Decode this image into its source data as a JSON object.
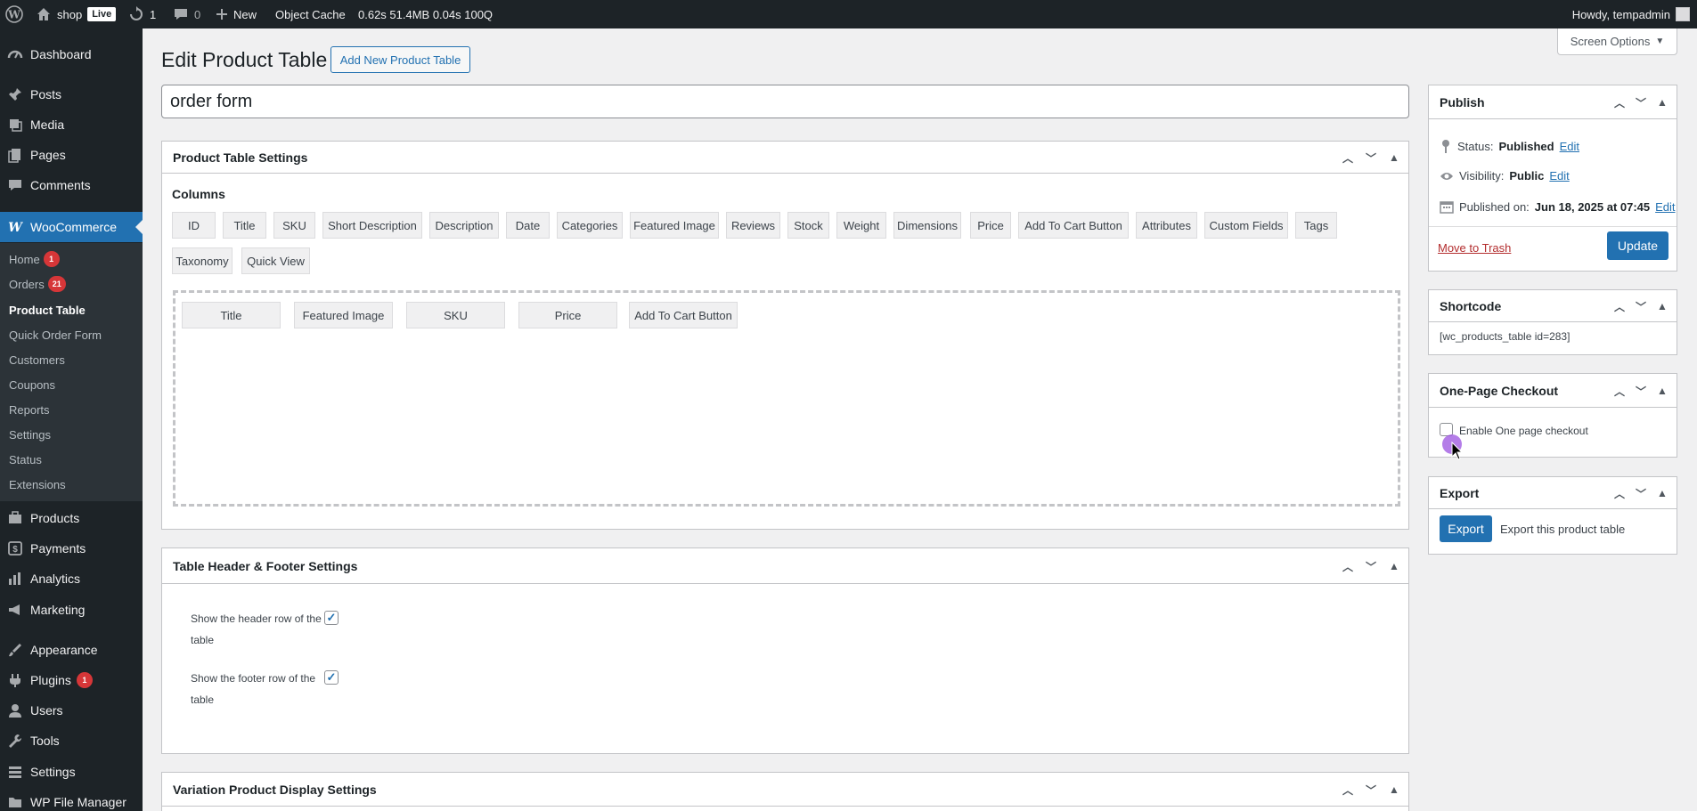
{
  "adminbar": {
    "site_name": "shop",
    "live_badge": "Live",
    "updates_count": "1",
    "comments_count": "0",
    "new_label": "New",
    "object_cache": "Object Cache",
    "perf": "0.62s 51.4MB 0.04s 100Q",
    "howdy": "Howdy, tempadmin"
  },
  "sidebar": {
    "items": [
      {
        "label": "Dashboard",
        "icon": "dashboard-icon"
      },
      {
        "label": "Posts",
        "icon": "pin-icon"
      },
      {
        "label": "Media",
        "icon": "media-icon"
      },
      {
        "label": "Pages",
        "icon": "pages-icon"
      },
      {
        "label": "Comments",
        "icon": "comments-icon"
      },
      {
        "label": "WooCommerce",
        "icon": "woocommerce-icon"
      },
      {
        "label": "Products",
        "icon": "products-icon"
      },
      {
        "label": "Payments",
        "icon": "payments-icon"
      },
      {
        "label": "Analytics",
        "icon": "analytics-icon"
      },
      {
        "label": "Marketing",
        "icon": "marketing-icon"
      },
      {
        "label": "Appearance",
        "icon": "appearance-icon"
      },
      {
        "label": "Plugins",
        "icon": "plugins-icon",
        "badge": "1"
      },
      {
        "label": "Users",
        "icon": "users-icon"
      },
      {
        "label": "Tools",
        "icon": "tools-icon"
      },
      {
        "label": "Settings",
        "icon": "settings-icon"
      },
      {
        "label": "WP File Manager",
        "icon": "file-manager-icon"
      }
    ],
    "submenu": [
      {
        "label": "Home",
        "badge": "1"
      },
      {
        "label": "Orders",
        "badge": "21"
      },
      {
        "label": "Product Table"
      },
      {
        "label": "Quick Order Form"
      },
      {
        "label": "Customers"
      },
      {
        "label": "Coupons"
      },
      {
        "label": "Reports"
      },
      {
        "label": "Settings"
      },
      {
        "label": "Status"
      },
      {
        "label": "Extensions"
      }
    ]
  },
  "page": {
    "title": "Edit Product Table",
    "add_new_label": "Add New Product Table",
    "screen_options": "Screen Options",
    "post_title": "order form"
  },
  "settings_box": {
    "title": "Product Table Settings",
    "columns_label": "Columns",
    "available_columns": [
      "ID",
      "Title",
      "SKU",
      "Short Description",
      "Description",
      "Date",
      "Categories",
      "Featured Image",
      "Reviews",
      "Stock",
      "Weight",
      "Dimensions",
      "Price",
      "Add To Cart Button",
      "Attributes",
      "Custom Fields",
      "Tags",
      "Taxonomy",
      "Quick View"
    ],
    "selected_columns": [
      "Title",
      "Featured Image",
      "SKU",
      "Price",
      "Add To Cart Button"
    ]
  },
  "header_footer_box": {
    "title": "Table Header & Footer Settings",
    "show_header_label_1": "Show the header row of the",
    "show_header_label_2": "table",
    "show_footer_label_1": "Show the footer row of the",
    "show_footer_label_2": "table",
    "check_mark": "✓"
  },
  "variation_box": {
    "title": "Variation Product Display Settings"
  },
  "publish": {
    "title": "Publish",
    "status_label": "Status:",
    "status_value": "Published",
    "visibility_label": "Visibility:",
    "visibility_value": "Public",
    "published_label": "Published on:",
    "published_value": "Jun 18, 2025 at 07:45",
    "edit_label": "Edit",
    "trash_label": "Move to Trash",
    "update_label": "Update"
  },
  "shortcode": {
    "title": "Shortcode",
    "value": "[wc_products_table id=283]"
  },
  "checkout": {
    "title": "One-Page Checkout",
    "enable_label": "Enable One page checkout"
  },
  "export": {
    "title": "Export",
    "button_label": "Export",
    "description": "Export this product table"
  },
  "colors": {
    "accent": "#2271b1",
    "adminbar": "#1d2327",
    "badge": "#d63638"
  }
}
